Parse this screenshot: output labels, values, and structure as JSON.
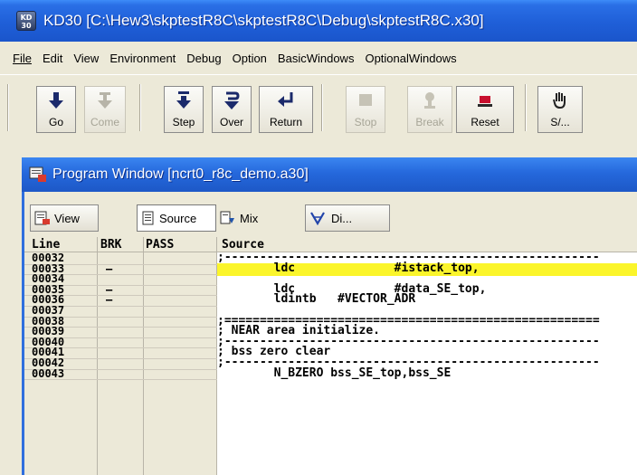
{
  "window": {
    "title": "KD30 [C:\\Hew3\\skptestR8C\\skptestR8C\\Debug\\skptestR8C.x30]",
    "icon_text_top": "KD",
    "icon_text_bottom": "30"
  },
  "menu": [
    {
      "label": "File"
    },
    {
      "label": "Edit"
    },
    {
      "label": "View"
    },
    {
      "label": "Environment"
    },
    {
      "label": "Debug"
    },
    {
      "label": "Option"
    },
    {
      "label": "BasicWindows"
    },
    {
      "label": "OptionalWindows"
    }
  ],
  "toolbar": {
    "buttons": [
      {
        "label": "Go",
        "icon": "go-arrow-icon",
        "enabled": true
      },
      {
        "label": "Come",
        "icon": "come-icon",
        "enabled": false
      },
      {
        "label": "Step",
        "icon": "step-icon",
        "enabled": true
      },
      {
        "label": "Over",
        "icon": "over-icon",
        "enabled": true
      },
      {
        "label": "Return",
        "icon": "return-icon",
        "enabled": true
      },
      {
        "label": "Stop",
        "icon": "stop-icon",
        "enabled": false
      },
      {
        "label": "Break",
        "icon": "break-icon",
        "enabled": false
      },
      {
        "label": "Reset",
        "icon": "reset-icon",
        "enabled": true
      },
      {
        "label": "S/...",
        "icon": "hand-pointer-icon",
        "enabled": true
      }
    ]
  },
  "program_window": {
    "title": "Program Window [ncrt0_r8c_demo.a30]",
    "buttons": [
      {
        "label": "View",
        "icon": "view-icon"
      },
      {
        "label": "Source",
        "icon": "source-icon"
      },
      {
        "label": "Mix",
        "icon": "mix-icon"
      },
      {
        "label": "Di...",
        "icon": "disasm-icon"
      }
    ],
    "columns": [
      "Line",
      "BRK",
      "PASS",
      "Source"
    ],
    "highlight_color": "#fbf52b",
    "rows": [
      {
        "line": "00032",
        "brk": "",
        "source": ";-----------------------------------------------------"
      },
      {
        "line": "00033",
        "brk": "–",
        "source": "        ldc              #istack_top,",
        "highlight": true
      },
      {
        "line": "00034",
        "brk": "",
        "source": ""
      },
      {
        "line": "00035",
        "brk": "–",
        "source": "        ldc              #data_SE_top,"
      },
      {
        "line": "00036",
        "brk": "–",
        "source": "        ldintb   #VECTOR_ADR"
      },
      {
        "line": "00037",
        "brk": "",
        "source": ""
      },
      {
        "line": "00038",
        "brk": "",
        "source": ";====================================================="
      },
      {
        "line": "00039",
        "brk": "",
        "source": "; NEAR area initialize."
      },
      {
        "line": "00040",
        "brk": "",
        "source": ";-----------------------------------------------------"
      },
      {
        "line": "00041",
        "brk": "",
        "source": "; bss zero clear"
      },
      {
        "line": "00042",
        "brk": "",
        "source": ";-----------------------------------------------------"
      },
      {
        "line": "00043",
        "brk": "",
        "source": "        N_BZERO bss_SE_top,bss_SE"
      }
    ]
  }
}
